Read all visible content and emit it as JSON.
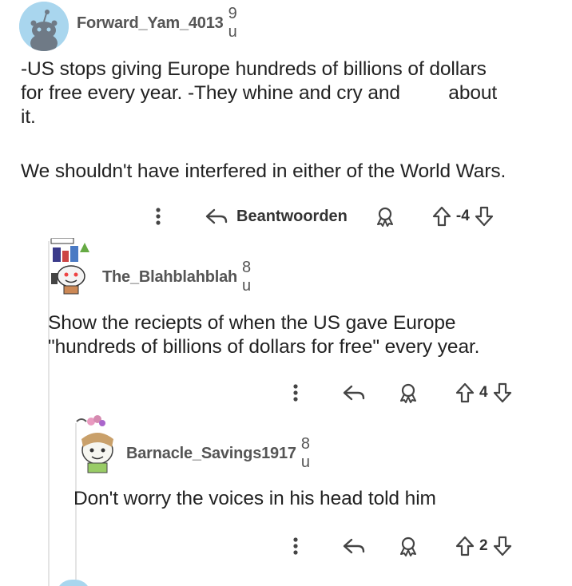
{
  "comments": [
    {
      "username": "Forward_Yam_4013",
      "age": "9 u",
      "body_lines": [
        "-US stops giving Europe hundreds of billions of dollars",
        "for free every year. -They whine and cry and         about",
        "it.",
        "",
        "We shouldn't have interfered in either of the World Wars."
      ],
      "reply_label": "Beantwoorden",
      "votes": "-4"
    },
    {
      "username": "The_Blahblahblah",
      "age": "8 u",
      "body_lines": [
        "Show the reciepts of when the US gave Europe",
        "\"hundreds of billions of dollars for free\" every year."
      ],
      "votes": "4"
    },
    {
      "username": "Barnacle_Savings1917",
      "age": "8 u",
      "body_lines": [
        "Don't worry the voices in his head told him"
      ],
      "votes": "2"
    }
  ],
  "icons": {
    "more": "more-vertical-icon",
    "reply": "reply-arrow-icon",
    "award": "award-icon",
    "upvote": "upvote-arrow-icon",
    "downvote": "downvote-arrow-icon"
  },
  "colors": {
    "text": "#222222",
    "meta": "#555555",
    "icon": "#444444",
    "thread_line": "#e4e4e4"
  }
}
